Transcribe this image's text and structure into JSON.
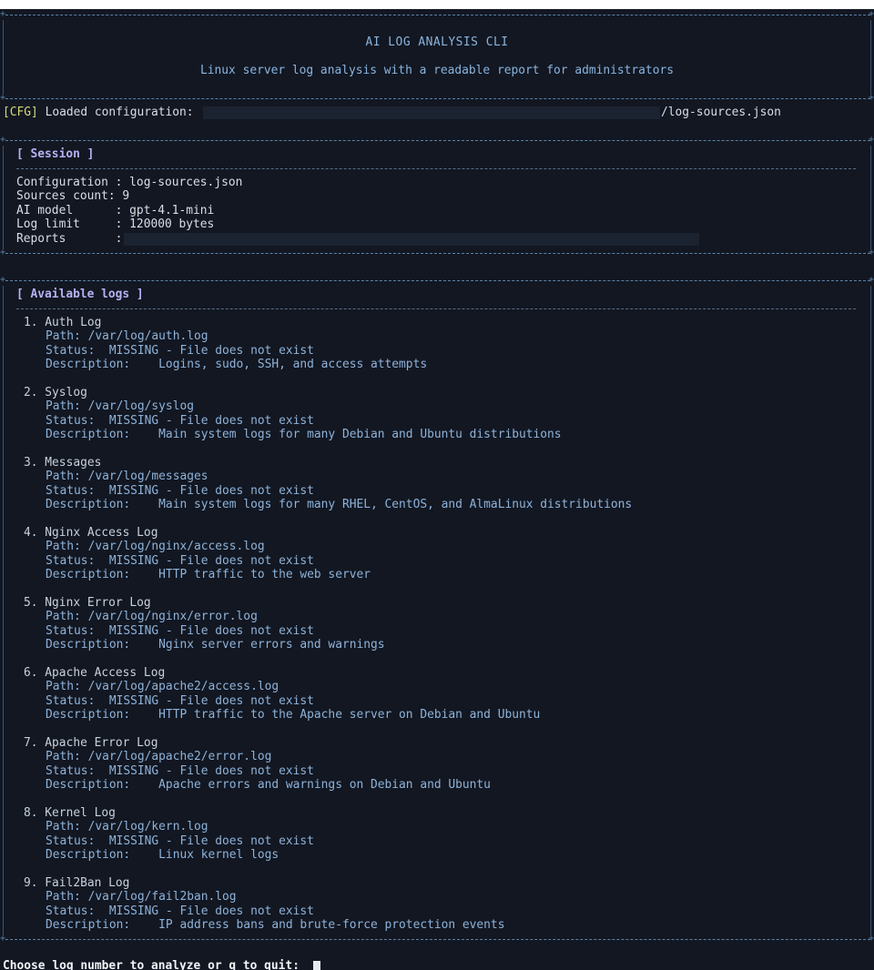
{
  "header": {
    "title": "AI LOG ANALYSIS CLI",
    "subtitle": "Linux server log analysis with a readable report for administrators"
  },
  "config_line": {
    "tag": "[CFG]",
    "label": "Loaded configuration:",
    "path_suffix": "/log-sources.json"
  },
  "session": {
    "heading": "[ Session ]",
    "configuration": "Configuration : log-sources.json",
    "sources_count": "Sources count: 9",
    "ai_model": "AI model      : gpt-4.1-mini",
    "log_limit": "Log limit     : 120000 bytes",
    "reports": "Reports       :"
  },
  "logs": {
    "heading": "[ Available logs ]",
    "items": [
      {
        "name": "1. Auth Log",
        "path": "Path: /var/log/auth.log",
        "status": "Status:  MISSING - File does not exist",
        "description": "Description:    Logins, sudo, SSH, and access attempts"
      },
      {
        "name": "2. Syslog",
        "path": "Path: /var/log/syslog",
        "status": "Status:  MISSING - File does not exist",
        "description": "Description:    Main system logs for many Debian and Ubuntu distributions"
      },
      {
        "name": "3. Messages",
        "path": "Path: /var/log/messages",
        "status": "Status:  MISSING - File does not exist",
        "description": "Description:    Main system logs for many RHEL, CentOS, and AlmaLinux distributions"
      },
      {
        "name": "4. Nginx Access Log",
        "path": "Path: /var/log/nginx/access.log",
        "status": "Status:  MISSING - File does not exist",
        "description": "Description:    HTTP traffic to the web server"
      },
      {
        "name": "5. Nginx Error Log",
        "path": "Path: /var/log/nginx/error.log",
        "status": "Status:  MISSING - File does not exist",
        "description": "Description:    Nginx server errors and warnings"
      },
      {
        "name": "6. Apache Access Log",
        "path": "Path: /var/log/apache2/access.log",
        "status": "Status:  MISSING - File does not exist",
        "description": "Description:    HTTP traffic to the Apache server on Debian and Ubuntu"
      },
      {
        "name": "7. Apache Error Log",
        "path": "Path: /var/log/apache2/error.log",
        "status": "Status:  MISSING - File does not exist",
        "description": "Description:    Apache errors and warnings on Debian and Ubuntu"
      },
      {
        "name": "8. Kernel Log",
        "path": "Path: /var/log/kern.log",
        "status": "Status:  MISSING - File does not exist",
        "description": "Description:    Linux kernel logs"
      },
      {
        "name": "9. Fail2Ban Log",
        "path": "Path: /var/log/fail2ban.log",
        "status": "Status:  MISSING - File does not exist",
        "description": "Description:    IP address bans and brute-force protection events"
      }
    ]
  },
  "prompt": {
    "text": "Choose log number to analyze or q to quit:"
  }
}
